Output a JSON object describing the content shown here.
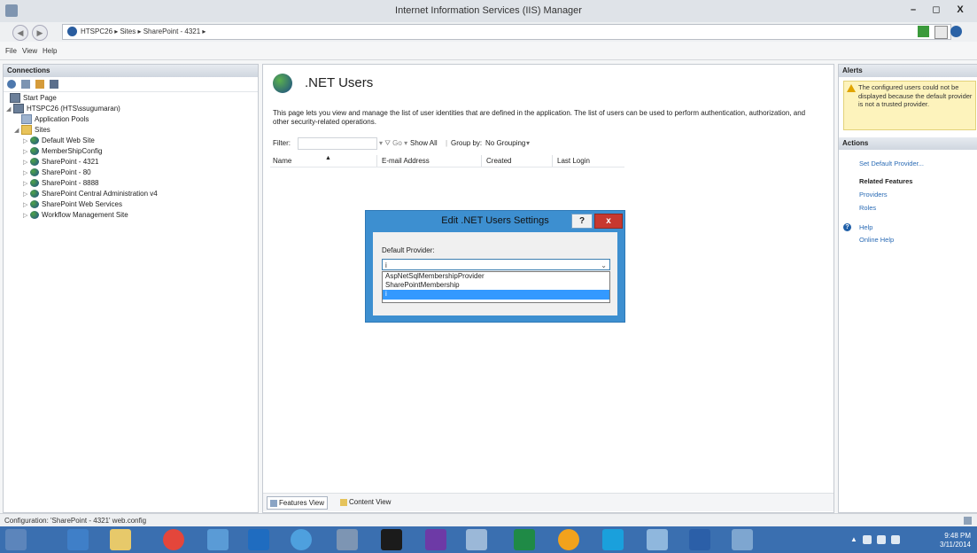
{
  "window": {
    "title": "Internet Information Services (IIS) Manager",
    "minimize": "–",
    "restore": "◻",
    "close": "X"
  },
  "address": {
    "crumbs": "HTSPC26  ▸  Sites  ▸  SharePoint - 4321  ▸"
  },
  "menu": {
    "file": "File",
    "view": "View",
    "help": "Help"
  },
  "connections": {
    "header": "Connections",
    "tree": [
      {
        "label": "Start Page",
        "icon": "start-page-icon"
      },
      {
        "label": "HTSPC26 (HTS\\ssugumaran)",
        "icon": "server-icon"
      },
      {
        "label": "Application Pools",
        "icon": "app-pool-icon"
      },
      {
        "label": "Sites",
        "icon": "folder-icon"
      },
      {
        "label": "Default Web Site",
        "icon": "globe-icon"
      },
      {
        "label": "MemberShipConfig",
        "icon": "globe-icon"
      },
      {
        "label": "SharePoint - 4321",
        "icon": "globe-icon"
      },
      {
        "label": "SharePoint - 80",
        "icon": "globe-icon"
      },
      {
        "label": "SharePoint - 8888",
        "icon": "globe-icon"
      },
      {
        "label": "SharePoint Central Administration v4",
        "icon": "globe-icon"
      },
      {
        "label": "SharePoint Web Services",
        "icon": "globe-icon"
      },
      {
        "label": "Workflow Management Site",
        "icon": "globe-icon"
      }
    ]
  },
  "main": {
    "title": ".NET Users",
    "description": "This page lets you view and manage the list of user identities that are defined in the application. The list of users can be used to perform authentication, authorization, and other security-related operations.",
    "filter_label": "Filter:",
    "show_all": "Show All",
    "group_by_label": "Group by:",
    "group_by_value": "No Grouping",
    "columns": [
      "Name",
      "E-mail Address",
      "Created",
      "Last Login"
    ],
    "tabs": {
      "features": "Features View",
      "content": "Content View"
    }
  },
  "dialog": {
    "title": "Edit .NET Users Settings",
    "help": "?",
    "close": "x",
    "field_label": "Default Provider:",
    "selected_value": "i",
    "options": [
      "AspNetSqlMembershipProvider",
      "SharePointMembership",
      "i"
    ]
  },
  "alerts": {
    "header": "Alerts",
    "message": "The configured users could not be displayed because the default provider is not a trusted provider."
  },
  "actions": {
    "header": "Actions",
    "set_default_provider": "Set Default Provider...",
    "related_features": "Related Features",
    "providers": "Providers",
    "roles": "Roles",
    "help": "Help",
    "online_help": "Online Help"
  },
  "status": {
    "text": "Configuration: 'SharePoint - 4321' web.config"
  },
  "taskbar": {
    "time": "9:48 PM",
    "date": "3/11/2014"
  },
  "colors": {
    "taskbar": "#3a6fb0",
    "dialog_frame": "#3d8fd0",
    "selection": "#3399ff",
    "alert_bg": "#fdf3bc",
    "link": "#2a6bb5"
  }
}
